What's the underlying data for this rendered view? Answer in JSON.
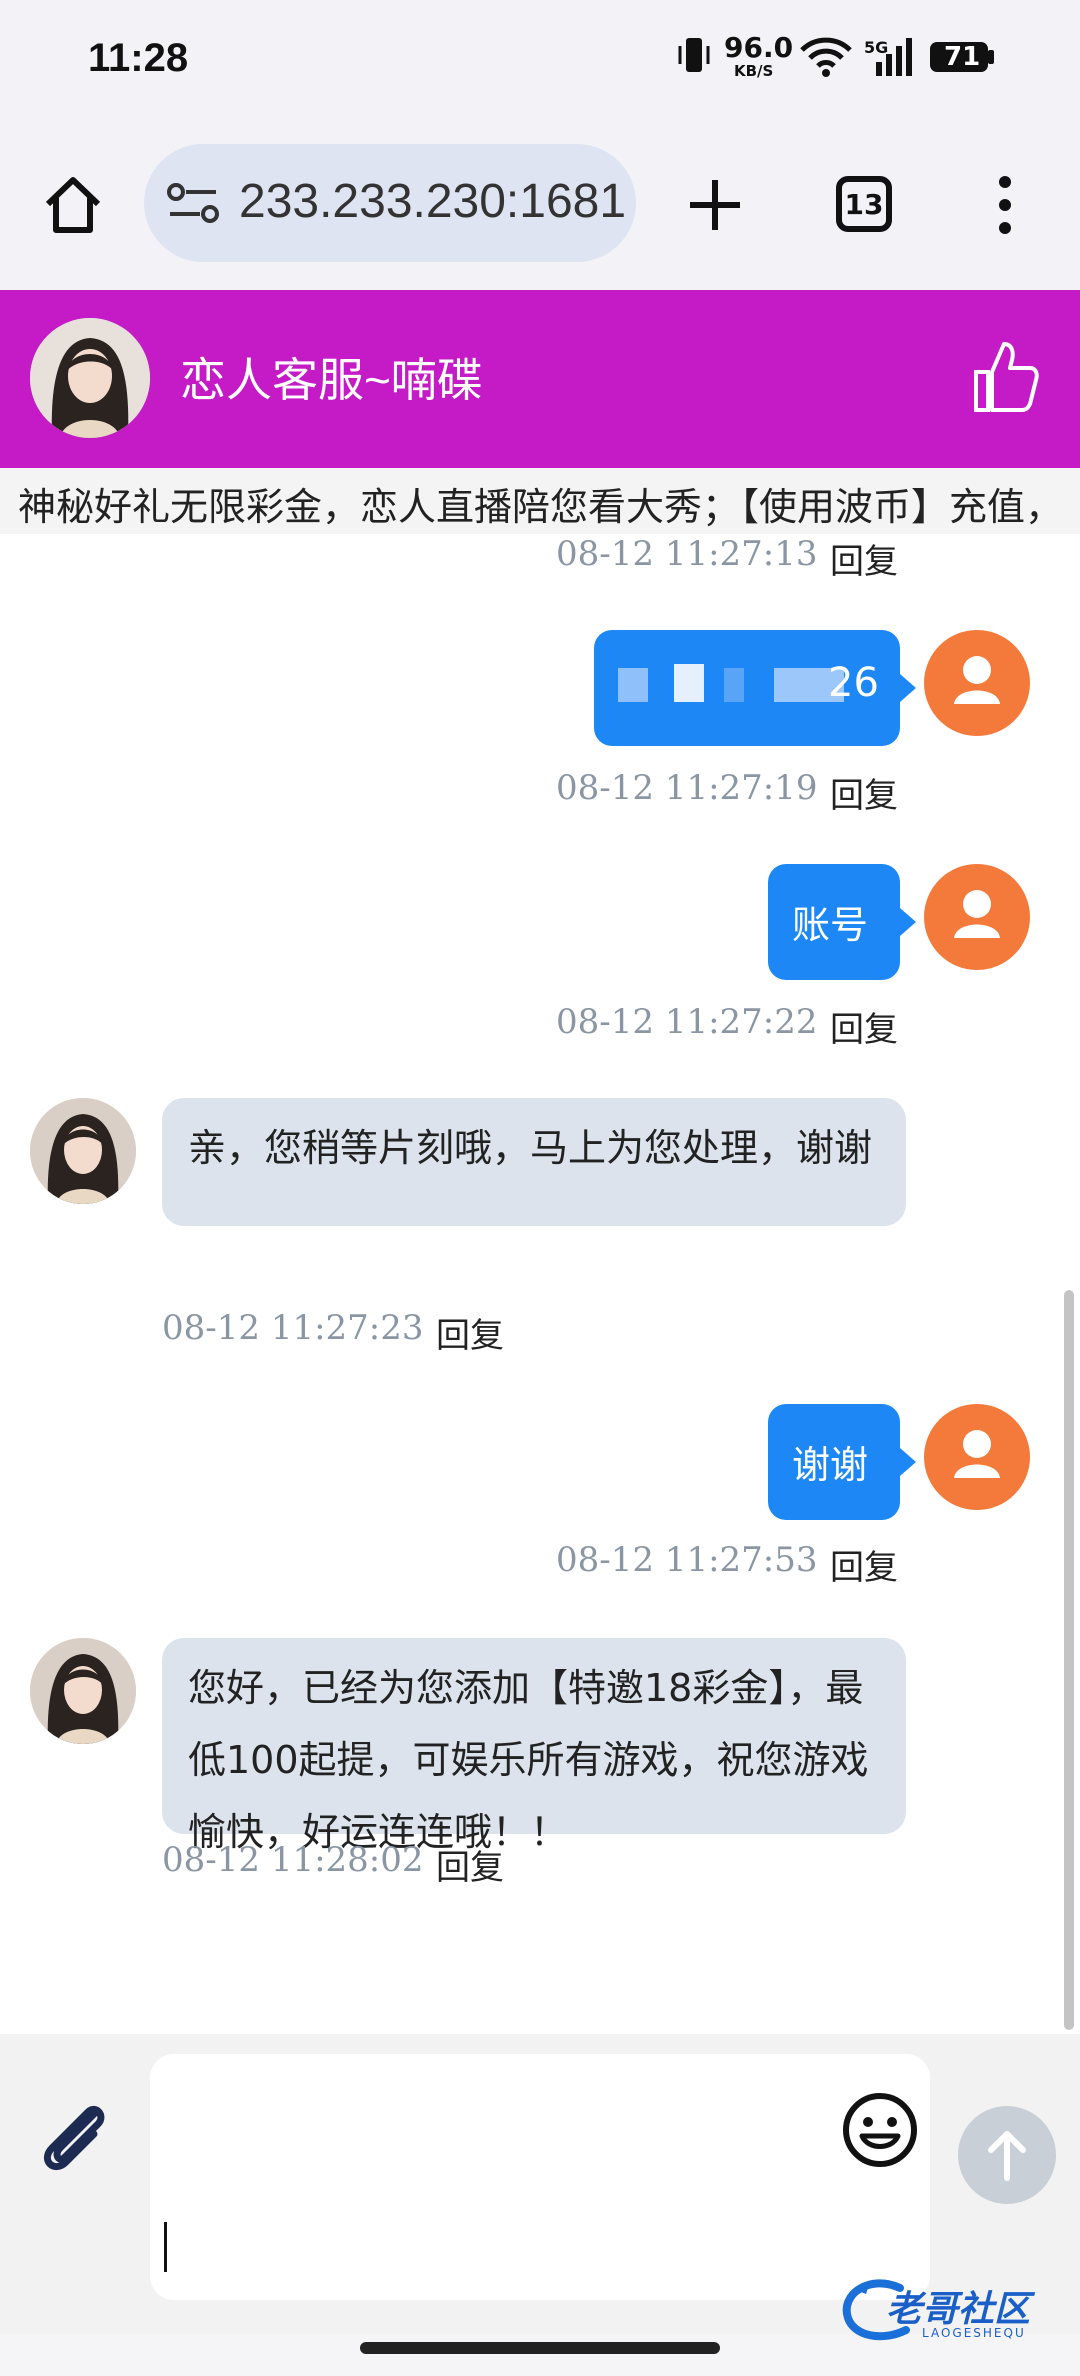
{
  "status_bar": {
    "time": "11:28",
    "net_speed_value": "96.0",
    "net_speed_unit": "KB/S",
    "network_label": "5G",
    "battery": "71",
    "icons": [
      "vibrate-icon",
      "wifi-icon",
      "signal-icon",
      "battery-icon"
    ]
  },
  "browser": {
    "url": "233.233.230:1681",
    "tab_count": "13",
    "icons": [
      "home-icon",
      "site-settings-icon",
      "new-tab-icon",
      "tabs-icon",
      "more-icon"
    ]
  },
  "chat_header": {
    "title": "恋人客服~喃碟",
    "brand_color": "#c41bc6"
  },
  "marquee": {
    "text": "神秘好礼无限彩金，恋人直播陪您看大秀；【使用波币】充值，"
  },
  "reply_label": "回复",
  "messages": [
    {
      "id": "m0",
      "direction": "out",
      "text": "",
      "time": "08-12 11:27:13"
    },
    {
      "id": "m1",
      "direction": "out",
      "text": "26",
      "redacted": true,
      "time": "08-12 11:27:19"
    },
    {
      "id": "m2",
      "direction": "out",
      "text": "账号",
      "time": "08-12 11:27:22"
    },
    {
      "id": "m3",
      "direction": "in",
      "text": "亲，您稍等片刻哦，马上为您处理，谢谢",
      "time": "08-12 11:27:23"
    },
    {
      "id": "m4",
      "direction": "out",
      "text": "谢谢",
      "time": "08-12 11:27:53"
    },
    {
      "id": "m5",
      "direction": "in",
      "text": "您好，已经为您添加【特邀18彩金】，最低100起提，可娱乐所有游戏，祝您游戏愉快，好运连连哦！！",
      "time": "08-12 11:28:02"
    }
  ],
  "composer": {
    "value": "",
    "icons": [
      "attachment-icon",
      "emoji-icon",
      "send-arrow-icon"
    ]
  },
  "watermark": {
    "text": "老哥社区",
    "subtext": "LAOGESHEQU"
  },
  "colors": {
    "outgoing_bubble": "#1d88f5",
    "incoming_bubble": "#dce3ec",
    "user_avatar": "#f47a3c"
  }
}
